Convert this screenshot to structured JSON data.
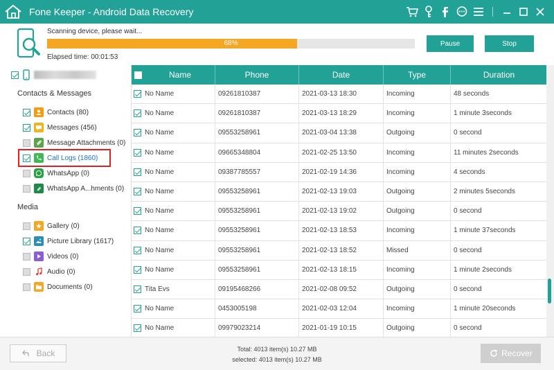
{
  "titlebar": {
    "title": "Fone Keeper - Android Data Recovery",
    "icons": [
      "cart-icon",
      "key-icon",
      "facebook-icon",
      "chat-icon",
      "menu-icon",
      "minimize-icon",
      "maximize-icon",
      "close-icon"
    ]
  },
  "scan": {
    "status": "Scanning device, please wait...",
    "progress_percent": 68,
    "progress_label": "68%",
    "elapsed": "Elapsed time: 00:01:53",
    "pause_label": "Pause",
    "stop_label": "Stop"
  },
  "sidebar": {
    "section_contacts": "Contacts & Messages",
    "section_media": "Media",
    "contacts_items": [
      {
        "label": "Contacts (80)",
        "icon": "contacts-icon",
        "checked": true,
        "color": "#f39c12"
      },
      {
        "label": "Messages (456)",
        "icon": "messages-icon",
        "checked": true,
        "color": "#f1b21c"
      },
      {
        "label": "Message Attachments (0)",
        "icon": "attachment-icon",
        "checked": false,
        "color": "#5aa54a"
      },
      {
        "label": "Call Logs (1860)",
        "icon": "phone-icon",
        "checked": true,
        "color": "#3cba54"
      },
      {
        "label": "WhatsApp (0)",
        "icon": "whatsapp-icon",
        "checked": false,
        "color": "#25a244"
      },
      {
        "label": "WhatsApp A...hments (0)",
        "icon": "whatsapp-attachments-icon",
        "checked": false,
        "color": "#1c8a4a"
      }
    ],
    "media_items": [
      {
        "label": "Gallery (0)",
        "icon": "gallery-icon",
        "checked": false,
        "color": "#f5a623"
      },
      {
        "label": "Picture Library (1617)",
        "icon": "picture-icon",
        "checked": true,
        "color": "#2a8fb8"
      },
      {
        "label": "Videos (0)",
        "icon": "video-icon",
        "checked": false,
        "color": "#8e5bd6"
      },
      {
        "label": "Audio (0)",
        "icon": "audio-icon",
        "checked": false,
        "color": "#e0463b"
      },
      {
        "label": "Documents (0)",
        "icon": "documents-icon",
        "checked": false,
        "color": "#f5a623"
      }
    ]
  },
  "table": {
    "headers": [
      "Name",
      "Phone",
      "Date",
      "Type",
      "Duration"
    ],
    "rows": [
      [
        "No Name",
        "09261810387",
        "2021-03-13 18:30",
        "Incoming",
        "48 seconds"
      ],
      [
        "No Name",
        "09261810387",
        "2021-03-13 18:29",
        "Incoming",
        "1 minute 3seconds"
      ],
      [
        "No Name",
        "09553258961",
        "2021-03-04 13:38",
        "Outgoing",
        "0 second"
      ],
      [
        "No Name",
        "09665348804",
        "2021-02-25 13:50",
        "Incoming",
        "11 minutes 2seconds"
      ],
      [
        "No Name",
        "09387785557",
        "2021-02-19 14:36",
        "Incoming",
        "4 seconds"
      ],
      [
        "No Name",
        "09553258961",
        "2021-02-13 19:03",
        "Outgoing",
        "2 minutes 5seconds"
      ],
      [
        "No Name",
        "09553258961",
        "2021-02-13 19:02",
        "Outgoing",
        "0 second"
      ],
      [
        "No Name",
        "09553258961",
        "2021-02-13 18:53",
        "Incoming",
        "1 minute 37seconds"
      ],
      [
        "No Name",
        "09553258961",
        "2021-02-13 18:52",
        "Missed",
        "0 second"
      ],
      [
        "No Name",
        "09553258961",
        "2021-02-13 18:15",
        "Incoming",
        "1 minute 2seconds"
      ],
      [
        "Tita Evs",
        "09195468266",
        "2021-02-08 09:52",
        "Outgoing",
        "0 second"
      ],
      [
        "No Name",
        "0453005198",
        "2021-02-03 12:04",
        "Incoming",
        "1 minute 20seconds"
      ],
      [
        "No Name",
        "09979023214",
        "2021-01-19 10:15",
        "Outgoing",
        "0 second"
      ]
    ]
  },
  "footer": {
    "back_label": "Back",
    "total": "Total: 4013 item(s) 10.27 MB",
    "selected": "selected: 4013 item(s) 10.27 MB",
    "recover_label": "Recover"
  },
  "colors": {
    "accent": "#22a297",
    "progress": "#f5a623",
    "highlight": "#e02020",
    "selected_text": "#1a73c8"
  }
}
